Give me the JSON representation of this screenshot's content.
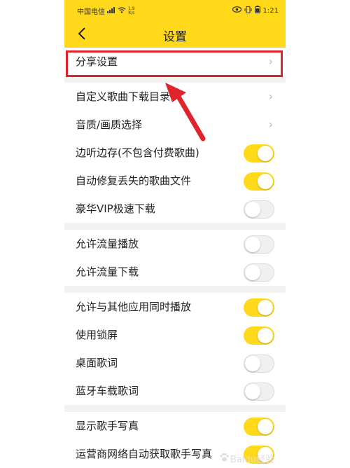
{
  "status_bar": {
    "carrier": "中国电信",
    "speed_value": "1.9",
    "speed_unit": "K/s",
    "time": "1:21"
  },
  "header": {
    "title": "设置"
  },
  "groups": [
    {
      "rows": [
        {
          "label": "分享设置",
          "type": "chevron"
        }
      ]
    },
    {
      "rows": [
        {
          "label": "自定义歌曲下载目录",
          "type": "chevron"
        },
        {
          "label": "音质/画质选择",
          "type": "chevron"
        },
        {
          "label": "边听边存(不包含付费歌曲)",
          "type": "toggle",
          "on": true
        },
        {
          "label": "自动修复丢失的歌曲文件",
          "type": "toggle",
          "on": true
        },
        {
          "label": "豪华VIP极速下载",
          "type": "toggle",
          "on": false
        }
      ]
    },
    {
      "rows": [
        {
          "label": "允许流量播放",
          "type": "toggle",
          "on": false
        },
        {
          "label": "允许流量下载",
          "type": "toggle",
          "on": false
        }
      ]
    },
    {
      "rows": [
        {
          "label": "允许与其他应用同时播放",
          "type": "toggle",
          "on": true
        },
        {
          "label": "使用锁屏",
          "type": "toggle",
          "on": true
        },
        {
          "label": "桌面歌词",
          "type": "toggle",
          "on": false
        },
        {
          "label": "蓝牙车载歌词",
          "type": "toggle",
          "on": false
        }
      ]
    },
    {
      "rows": [
        {
          "label": "显示歌手写真",
          "type": "toggle",
          "on": true
        },
        {
          "label": "运营商网络自动获取歌手写真",
          "type": "toggle",
          "on": true
        }
      ]
    }
  ],
  "watermark": "Baidu经验",
  "colors": {
    "accent": "#ffd91a",
    "annotation": "#e0242b"
  }
}
